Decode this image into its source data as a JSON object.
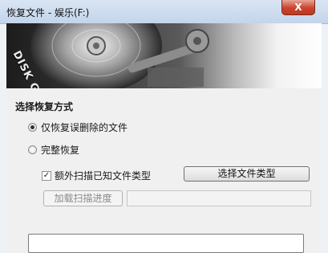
{
  "window": {
    "title": "恢复文件 - 娱乐(F:)",
    "close_label": "X"
  },
  "banner": {
    "brand_text": "DISK GENIUS"
  },
  "recovery": {
    "section_title": "选择恢复方式",
    "options": [
      {
        "label": "仅恢复误删除的文件",
        "selected": true
      },
      {
        "label": "完整恢复",
        "selected": false
      }
    ],
    "extra_scan": {
      "label": "额外扫描已知文件类型",
      "checked": true,
      "check_mark": "✓"
    },
    "select_types_button": "选择文件类型",
    "load_progress_button": "加载扫描进度",
    "progress_path_value": "",
    "bottom_field_value": ""
  },
  "colors": {
    "close_button": "#c8442d",
    "panel_bg": "#f0f0f0",
    "titlebar_bg": "#c3d5ec"
  }
}
